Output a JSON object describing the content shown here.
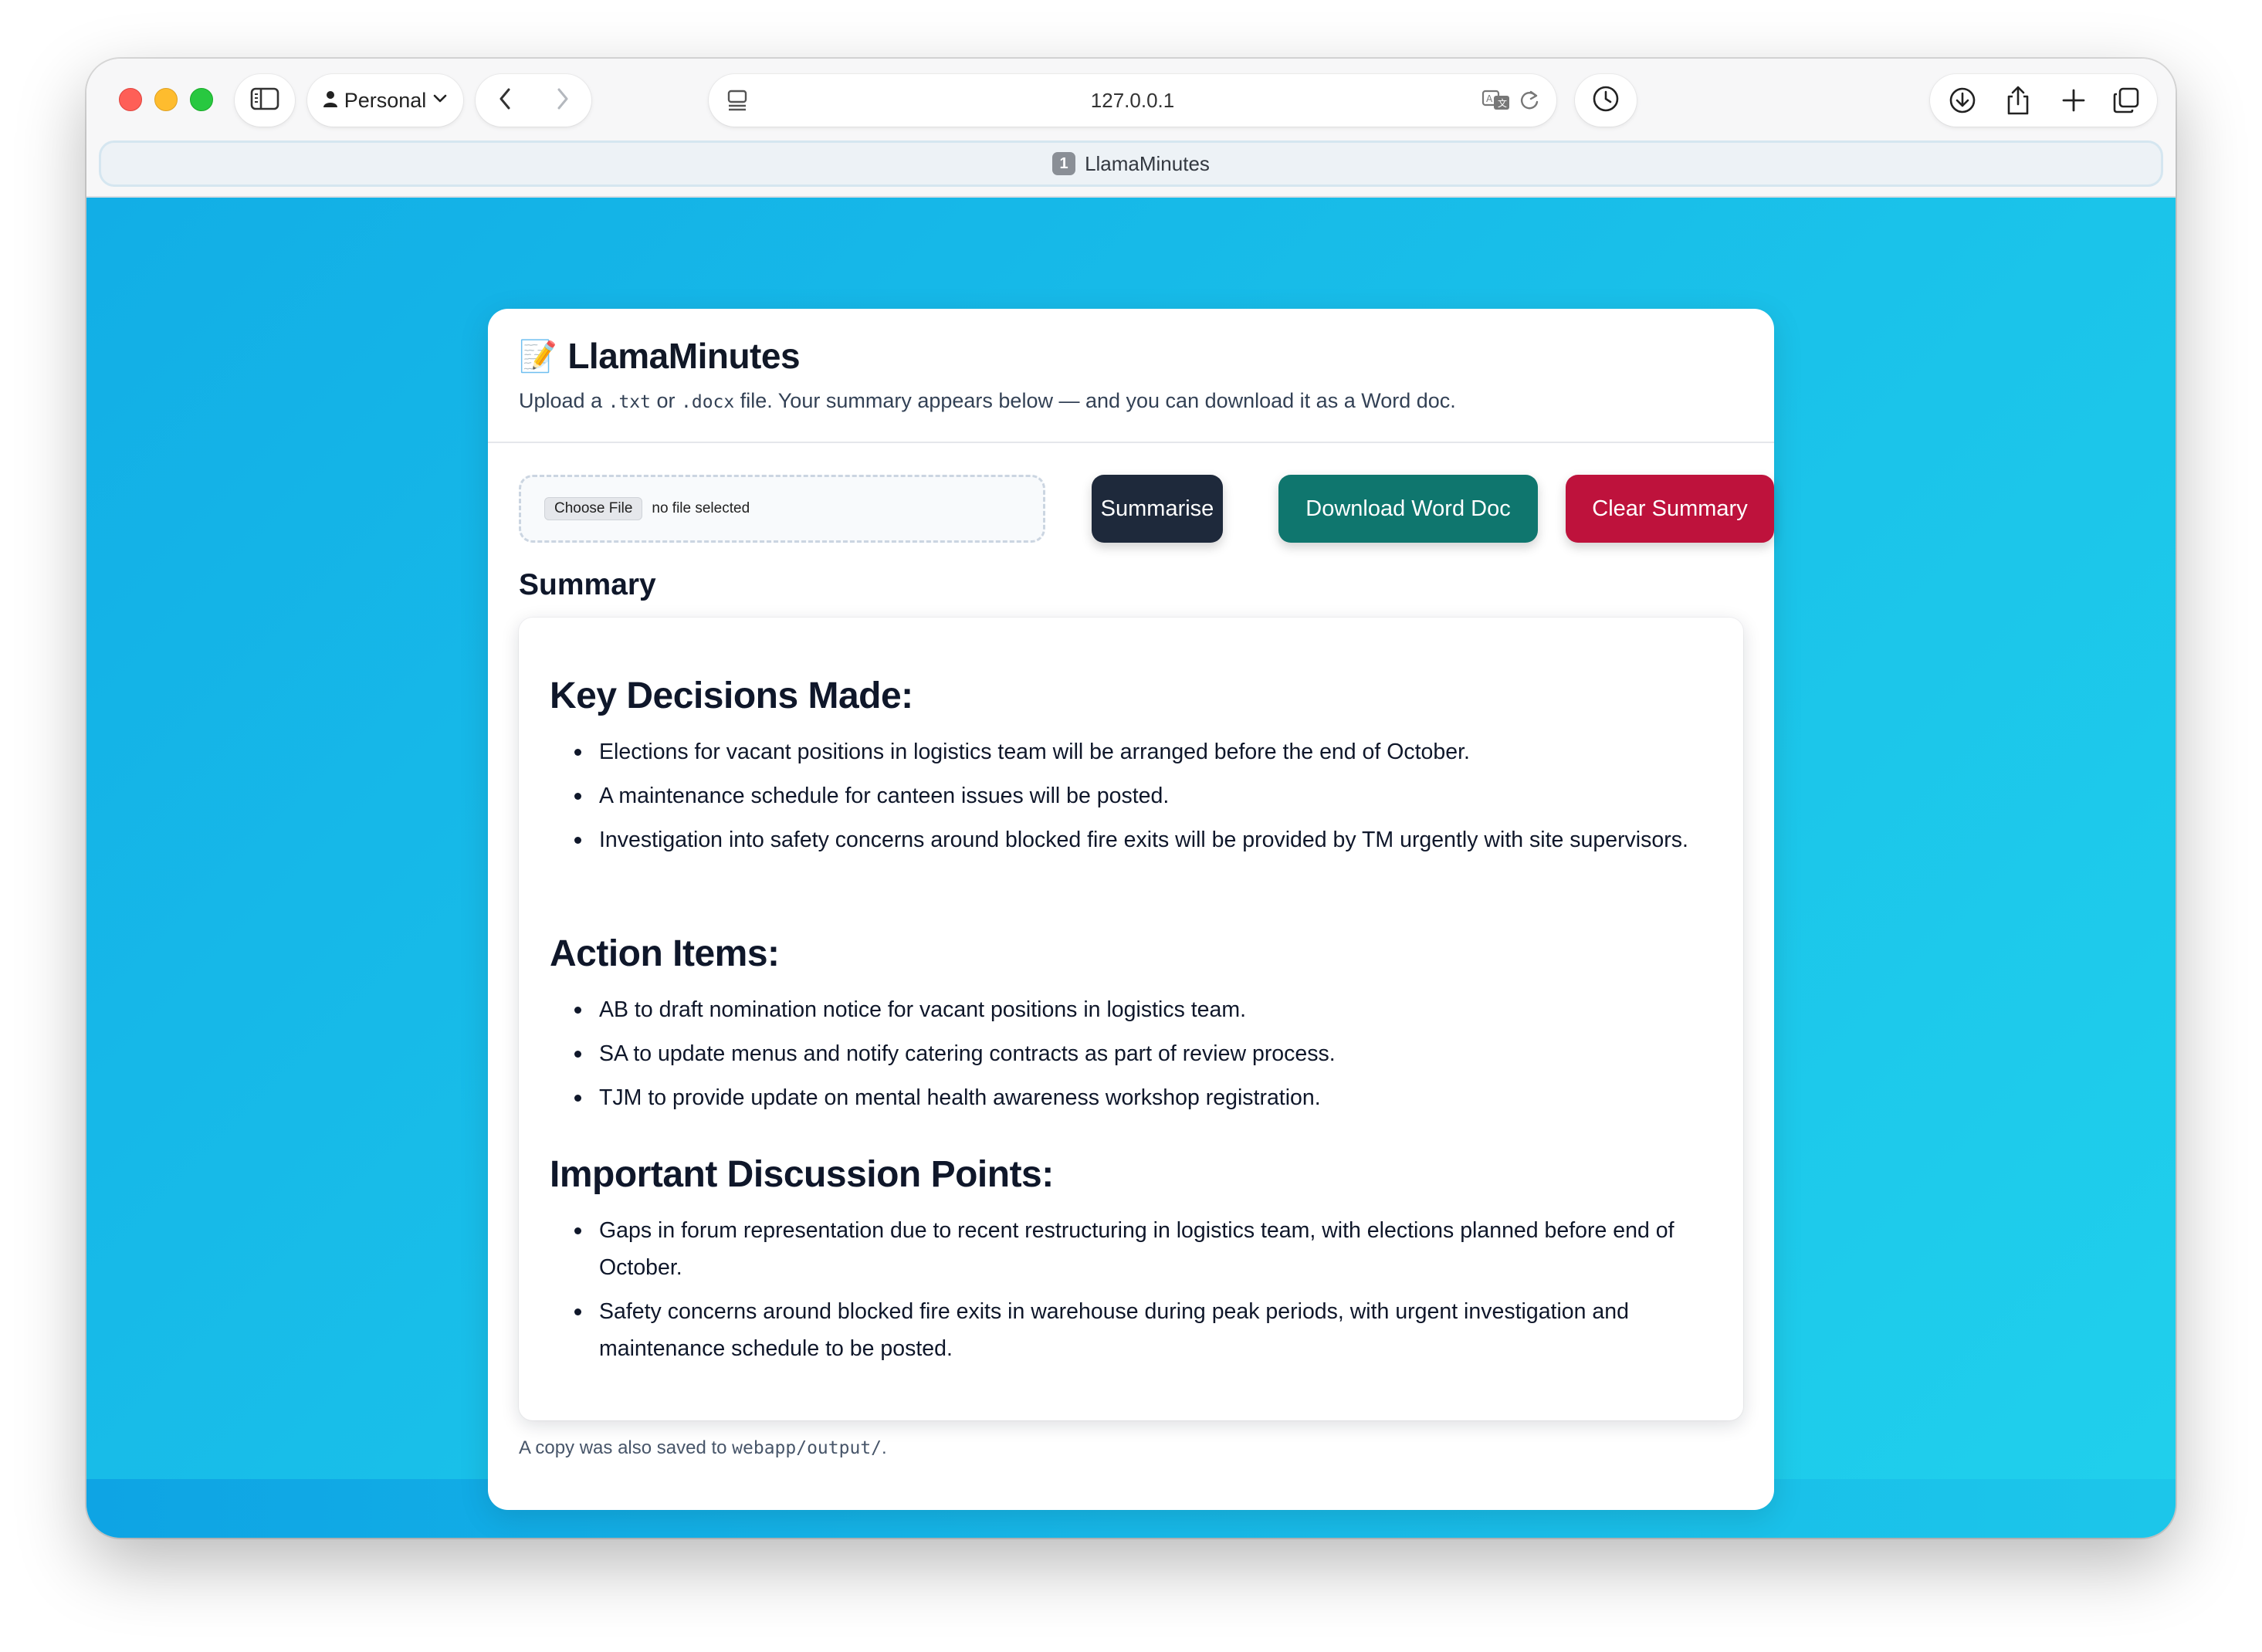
{
  "browser": {
    "profile_label": "Personal",
    "url": "127.0.0.1",
    "tab_number": "1",
    "tab_title": "LlamaMinutes"
  },
  "app": {
    "title_emoji": "📝",
    "title": "LlamaMinutes",
    "subtitle_prefix": "Upload a ",
    "subtitle_ext1": ".txt",
    "subtitle_mid": " or ",
    "subtitle_ext2": ".docx",
    "subtitle_suffix": " file. Your summary appears below — and you can download it as a Word doc."
  },
  "upload": {
    "choose_file_label": "Choose File",
    "file_status": "no file selected"
  },
  "buttons": {
    "summarise": "Summarise",
    "download": "Download Word Doc",
    "clear": "Clear Summary"
  },
  "summary": {
    "label": "Summary",
    "sections": [
      {
        "heading": "Key Decisions Made:",
        "items": [
          "Elections for vacant positions in logistics team will be arranged before the end of October.",
          "A maintenance schedule for canteen issues will be posted.",
          "Investigation into safety concerns around blocked fire exits will be provided by TM urgently with site supervisors."
        ]
      },
      {
        "heading": "Action Items:",
        "items": [
          "AB to draft nomination notice for vacant positions in logistics team.",
          "SA to update menus and notify catering contracts as part of review process.",
          "TJM to provide update on mental health awareness workshop registration."
        ]
      },
      {
        "heading": "Important Discussion Points:",
        "items": [
          "Gaps in forum representation due to recent restructuring in logistics team, with elections planned before end of October.",
          "Safety concerns around blocked fire exits in warehouse during peak periods, with urgent investigation and maintenance schedule to be posted."
        ]
      }
    ]
  },
  "footnote": {
    "prefix": "A copy was also saved to ",
    "path": "webapp/output/",
    "suffix": "."
  },
  "colors": {
    "summarise_button": "#1e293b",
    "download_button": "#0f766e",
    "clear_button": "#be123c",
    "background_gradient_start": "#12aee6",
    "background_gradient_end": "#20d0ec"
  },
  "icons": {
    "sidebar_toggle": "sidebar-icon",
    "profile": "person-icon",
    "back": "chevron-left-icon",
    "forward": "chevron-right-icon",
    "page_menu": "page-menu-icon",
    "translate": "translate-icon",
    "reload": "reload-icon",
    "history": "clock-icon",
    "downloads": "download-icon",
    "share": "share-icon",
    "new_tab": "plus-icon",
    "tab_overview": "tabs-icon"
  }
}
